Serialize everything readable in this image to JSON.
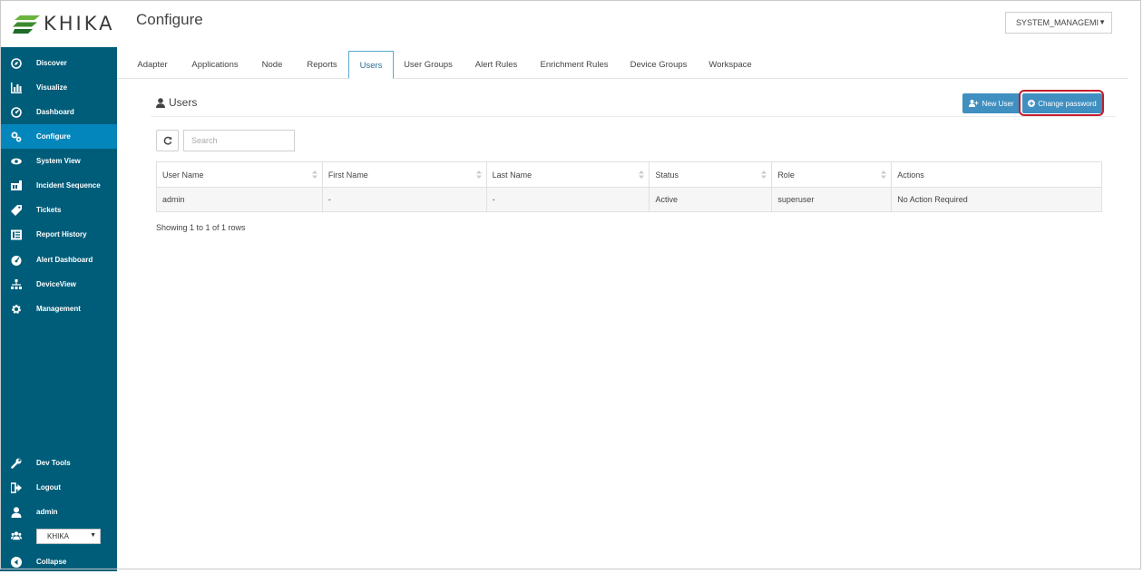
{
  "app": {
    "logo_text": "KHIKA"
  },
  "header": {
    "title": "Configure",
    "tenant_select": "SYSTEM_MANAGEMI"
  },
  "sidebar": {
    "items": [
      {
        "label": "Discover",
        "icon": "compass-icon"
      },
      {
        "label": "Visualize",
        "icon": "bar-chart-icon"
      },
      {
        "label": "Dashboard",
        "icon": "dashboard-icon"
      },
      {
        "label": "Configure",
        "icon": "cogs-icon",
        "active": true
      },
      {
        "label": "System View",
        "icon": "eye-icon"
      },
      {
        "label": "Incident Sequence",
        "icon": "sequence-icon"
      },
      {
        "label": "Tickets",
        "icon": "tag-icon"
      },
      {
        "label": "Report History",
        "icon": "list-icon"
      },
      {
        "label": "Alert Dashboard",
        "icon": "gauge-icon"
      },
      {
        "label": "DeviceView",
        "icon": "sitemap-icon"
      },
      {
        "label": "Management",
        "icon": "gear-icon"
      }
    ],
    "bottom": [
      {
        "label": "Dev Tools",
        "icon": "wrench-icon"
      },
      {
        "label": "Logout",
        "icon": "sign-out-icon"
      },
      {
        "label": "admin",
        "icon": "user-icon"
      }
    ],
    "org_select": "KHIKA",
    "collapse_label": "Collapse"
  },
  "tabs": [
    {
      "label": "Adapter"
    },
    {
      "label": "Applications"
    },
    {
      "label": "Node"
    },
    {
      "label": "Reports"
    },
    {
      "label": "Users",
      "active": true
    },
    {
      "label": "User Groups"
    },
    {
      "label": "Alert Rules"
    },
    {
      "label": "Enrichment Rules"
    },
    {
      "label": "Device Groups"
    },
    {
      "label": "Workspace"
    }
  ],
  "section": {
    "title": "Users",
    "new_user_label": "New User",
    "change_password_label": "Change password"
  },
  "search": {
    "placeholder": "Search",
    "value": ""
  },
  "table": {
    "columns": [
      "User Name",
      "First Name",
      "Last Name",
      "Status",
      "Role",
      "Actions"
    ],
    "rows": [
      [
        "admin",
        "-",
        "-",
        "Active",
        "superuser",
        "No Action Required"
      ]
    ],
    "footer": "Showing 1 to 1 of 1 rows"
  },
  "colors": {
    "sidebar_bg": "#005d7a",
    "sidebar_active": "#0386bb",
    "button_bg": "#3f8fc1",
    "highlight_ring": "#c41d2b",
    "logo_green": "#6bb33e"
  }
}
